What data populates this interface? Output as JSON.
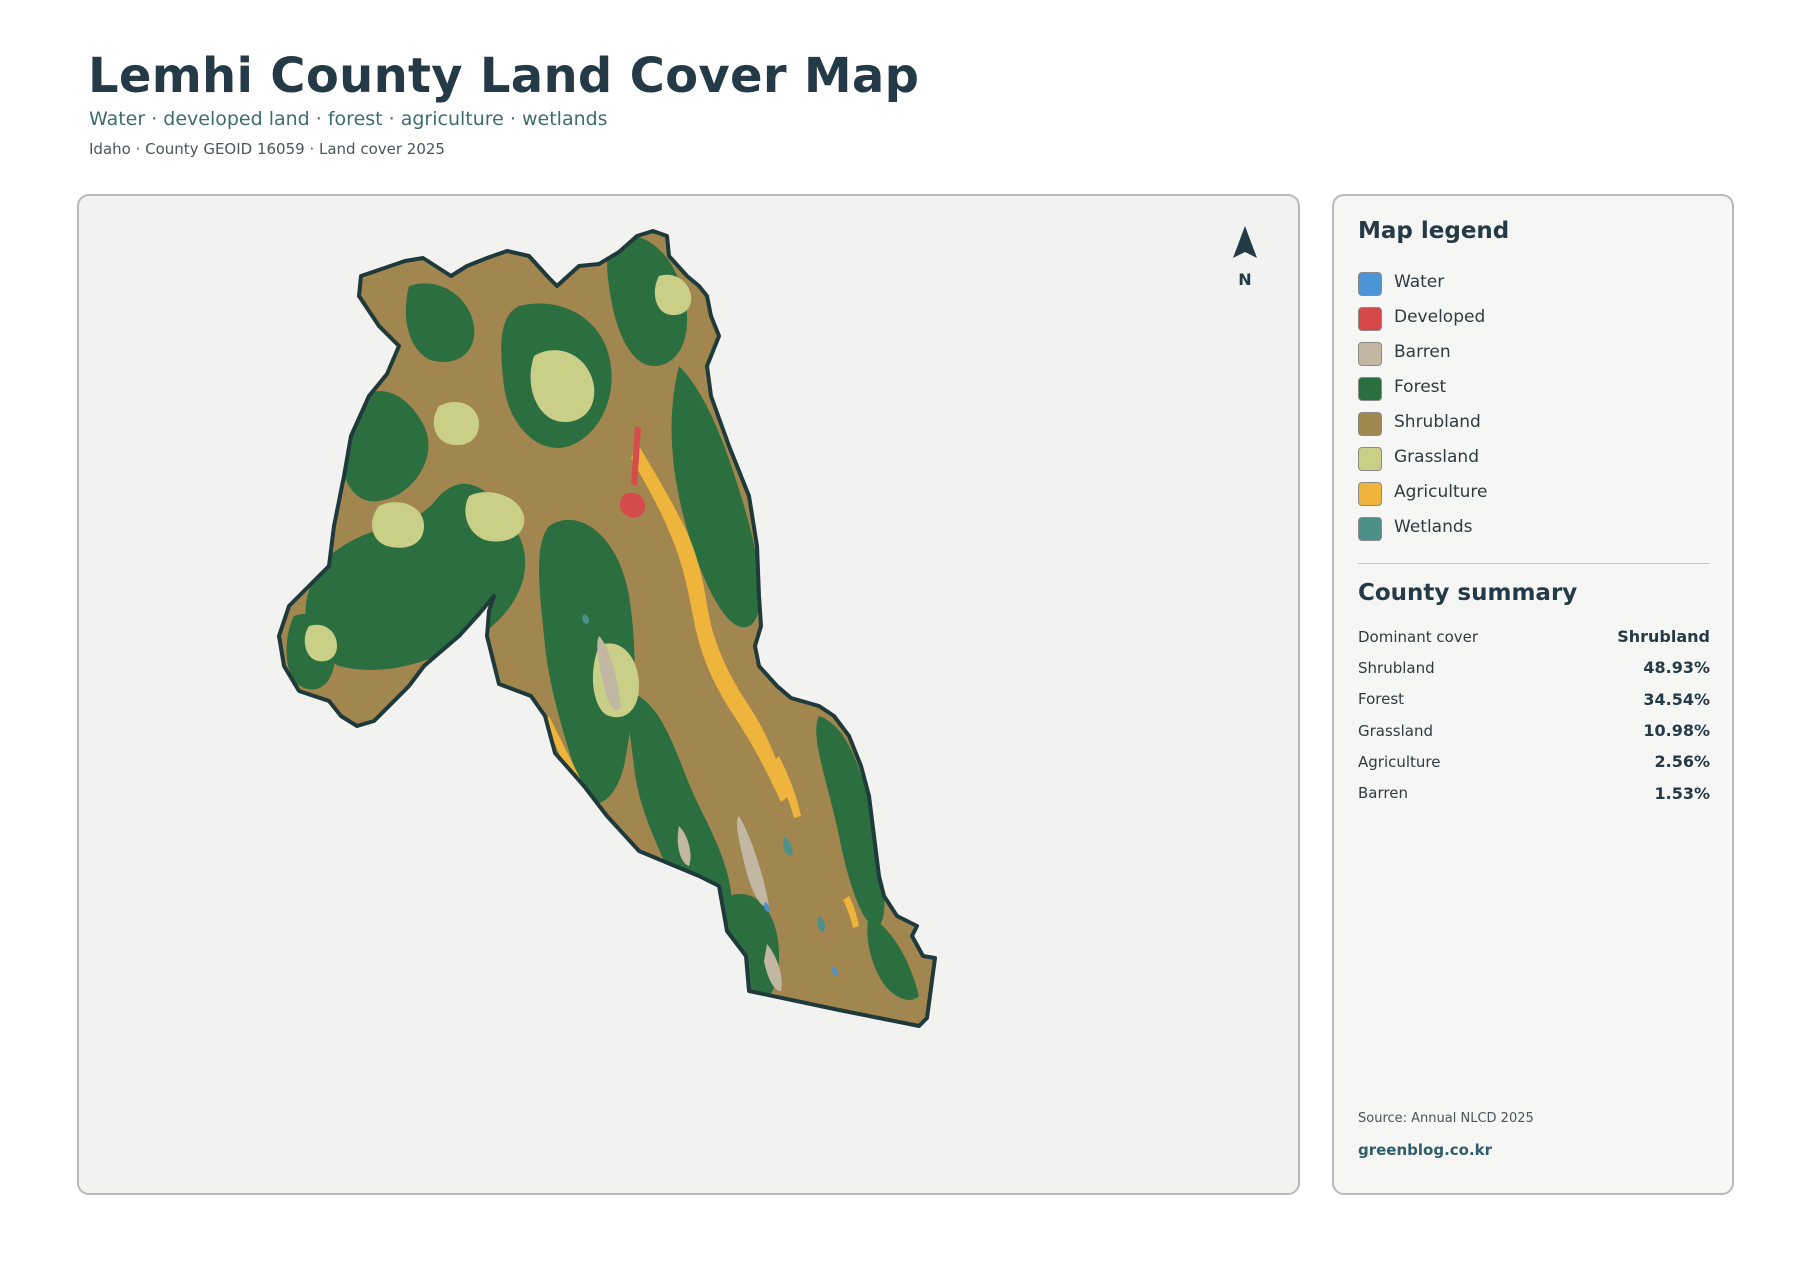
{
  "header": {
    "title": "Lemhi County Land Cover Map",
    "subtitle": "Water · developed land · forest · agriculture · wetlands",
    "meta": "Idaho · County GEOID 16059 · Land cover 2025"
  },
  "map": {
    "north_label": "N",
    "colors": {
      "outline": "#1f3a3a",
      "water": "#4f8fc9",
      "developed": "#d64b4b",
      "barren": "#c1b7a2",
      "forest": "#2b6e40",
      "shrubland": "#a1864f",
      "grassland": "#c9cf87",
      "agriculture": "#efb43b",
      "wetlands": "#4d9088"
    }
  },
  "legend": {
    "title": "Map legend",
    "items": [
      {
        "label": "Water",
        "color": "#4b95d6"
      },
      {
        "label": "Developed",
        "color": "#d64848"
      },
      {
        "label": "Barren",
        "color": "#c1b7a2"
      },
      {
        "label": "Forest",
        "color": "#2b6e40"
      },
      {
        "label": "Shrubland",
        "color": "#a1864f"
      },
      {
        "label": "Grassland",
        "color": "#c9cf87"
      },
      {
        "label": "Agriculture",
        "color": "#efb43b"
      },
      {
        "label": "Wetlands",
        "color": "#4d9088"
      }
    ]
  },
  "summary": {
    "title": "County summary",
    "rows": [
      {
        "label": "Dominant cover",
        "value": "Shrubland"
      },
      {
        "label": "Shrubland",
        "value": "48.93%"
      },
      {
        "label": "Forest",
        "value": "34.54%"
      },
      {
        "label": "Grassland",
        "value": "10.98%"
      },
      {
        "label": "Agriculture",
        "value": "2.56%"
      },
      {
        "label": "Barren",
        "value": "1.53%"
      }
    ]
  },
  "footer": {
    "source": "Source: Annual NLCD 2025",
    "brand": "greenblog.co.kr"
  }
}
